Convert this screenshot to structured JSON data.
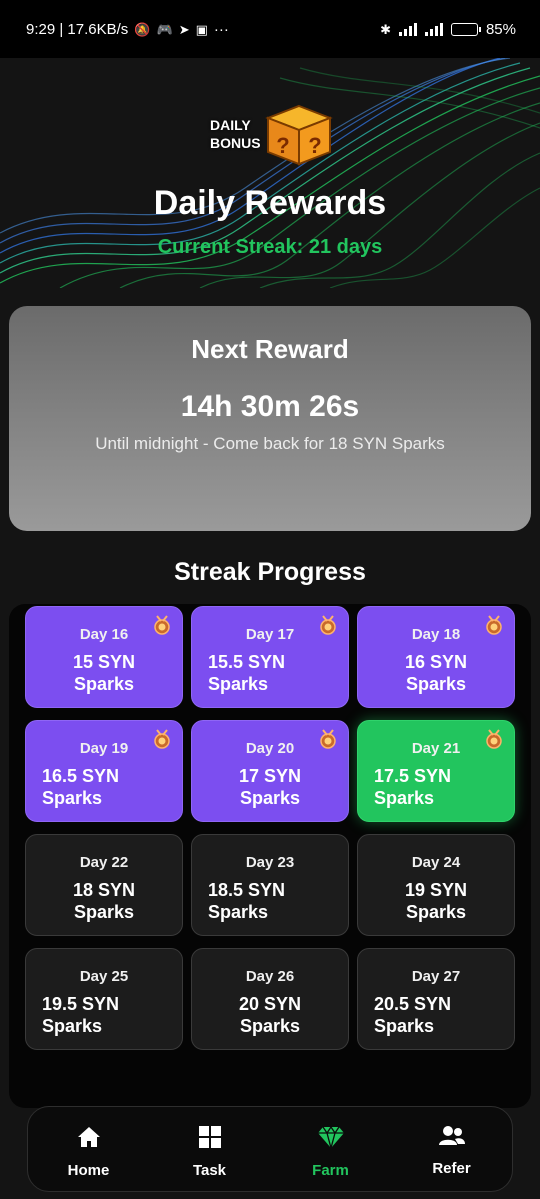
{
  "status_bar": {
    "time_speed": "9:29 | 17.6KB/s",
    "more": "···",
    "battery": "85",
    "battery_level": 0.85
  },
  "header": {
    "badge_line1": "DAILY",
    "badge_line2": "BONUS",
    "title": "Daily Rewards",
    "streak": "Current Streak: 21 days"
  },
  "next_reward": {
    "title": "Next Reward",
    "timer": "14h 30m 26s",
    "subtitle": "Until midnight - Come back for 18 SYN Sparks"
  },
  "streak_progress": {
    "title": "Streak Progress",
    "days": [
      {
        "label": "Day 16",
        "reward": "15 SYN Sparks",
        "state": "claimed"
      },
      {
        "label": "Day 17",
        "reward": "15.5 SYN Sparks",
        "state": "claimed"
      },
      {
        "label": "Day 18",
        "reward": "16 SYN Sparks",
        "state": "claimed"
      },
      {
        "label": "Day 19",
        "reward": "16.5 SYN Sparks",
        "state": "claimed"
      },
      {
        "label": "Day 20",
        "reward": "17 SYN Sparks",
        "state": "claimed"
      },
      {
        "label": "Day 21",
        "reward": "17.5 SYN Sparks",
        "state": "current"
      },
      {
        "label": "Day 22",
        "reward": "18 SYN Sparks",
        "state": "locked"
      },
      {
        "label": "Day 23",
        "reward": "18.5 SYN Sparks",
        "state": "locked"
      },
      {
        "label": "Day 24",
        "reward": "19 SYN Sparks",
        "state": "locked"
      },
      {
        "label": "Day 25",
        "reward": "19.5 SYN Sparks",
        "state": "locked"
      },
      {
        "label": "Day 26",
        "reward": "20 SYN Sparks",
        "state": "locked"
      },
      {
        "label": "Day 27",
        "reward": "20.5 SYN Sparks",
        "state": "locked"
      }
    ]
  },
  "nav": {
    "items": [
      {
        "label": "Home",
        "icon": "home-icon",
        "active": false
      },
      {
        "label": "Task",
        "icon": "grid-icon",
        "active": false
      },
      {
        "label": "Farm",
        "icon": "diamond-icon",
        "active": true
      },
      {
        "label": "Refer",
        "icon": "users-icon",
        "active": false
      }
    ]
  },
  "colors": {
    "accent_green": "#22c55e",
    "claimed_purple": "#7c4ef0",
    "locked_bg": "#1c1c1c",
    "background": "#141414"
  }
}
